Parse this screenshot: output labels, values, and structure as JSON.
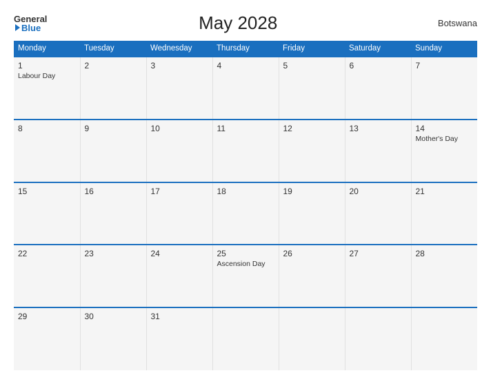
{
  "header": {
    "logo_general": "General",
    "logo_blue": "Blue",
    "title": "May 2028",
    "country": "Botswana"
  },
  "days_of_week": [
    "Monday",
    "Tuesday",
    "Wednesday",
    "Thursday",
    "Friday",
    "Saturday",
    "Sunday"
  ],
  "weeks": [
    [
      {
        "day": "1",
        "holiday": "Labour Day"
      },
      {
        "day": "2",
        "holiday": ""
      },
      {
        "day": "3",
        "holiday": ""
      },
      {
        "day": "4",
        "holiday": ""
      },
      {
        "day": "5",
        "holiday": ""
      },
      {
        "day": "6",
        "holiday": ""
      },
      {
        "day": "7",
        "holiday": ""
      }
    ],
    [
      {
        "day": "8",
        "holiday": ""
      },
      {
        "day": "9",
        "holiday": ""
      },
      {
        "day": "10",
        "holiday": ""
      },
      {
        "day": "11",
        "holiday": ""
      },
      {
        "day": "12",
        "holiday": ""
      },
      {
        "day": "13",
        "holiday": ""
      },
      {
        "day": "14",
        "holiday": "Mother's Day"
      }
    ],
    [
      {
        "day": "15",
        "holiday": ""
      },
      {
        "day": "16",
        "holiday": ""
      },
      {
        "day": "17",
        "holiday": ""
      },
      {
        "day": "18",
        "holiday": ""
      },
      {
        "day": "19",
        "holiday": ""
      },
      {
        "day": "20",
        "holiday": ""
      },
      {
        "day": "21",
        "holiday": ""
      }
    ],
    [
      {
        "day": "22",
        "holiday": ""
      },
      {
        "day": "23",
        "holiday": ""
      },
      {
        "day": "24",
        "holiday": ""
      },
      {
        "day": "25",
        "holiday": "Ascension Day"
      },
      {
        "day": "26",
        "holiday": ""
      },
      {
        "day": "27",
        "holiday": ""
      },
      {
        "day": "28",
        "holiday": ""
      }
    ],
    [
      {
        "day": "29",
        "holiday": ""
      },
      {
        "day": "30",
        "holiday": ""
      },
      {
        "day": "31",
        "holiday": ""
      },
      {
        "day": "",
        "holiday": ""
      },
      {
        "day": "",
        "holiday": ""
      },
      {
        "day": "",
        "holiday": ""
      },
      {
        "day": "",
        "holiday": ""
      }
    ]
  ]
}
